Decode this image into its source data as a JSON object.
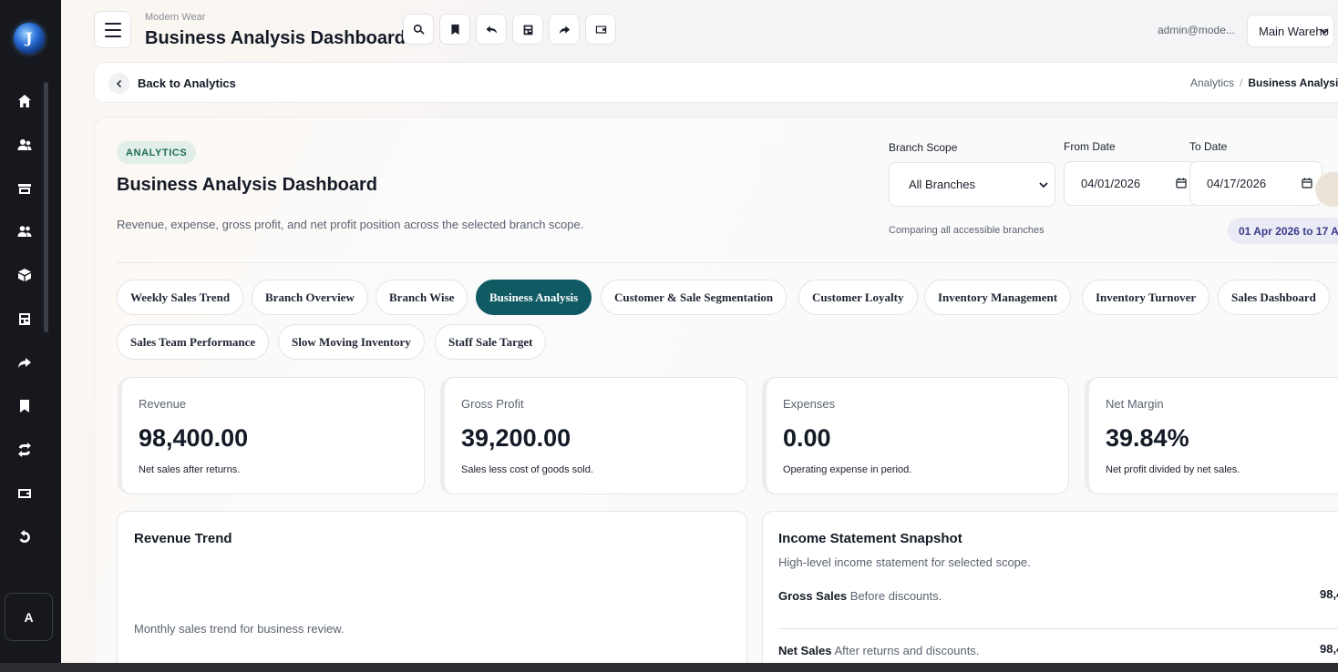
{
  "sidebar": {
    "logo_letter": "J",
    "icons": [
      "home-icon",
      "users-icon",
      "store-icon",
      "contacts-icon",
      "package-icon",
      "storefront-icon",
      "forward-icon",
      "bookmark-icon",
      "swap-icon",
      "wallet-icon",
      "return-icon"
    ],
    "avatar_letter": "A"
  },
  "header": {
    "brand_sub": "Modern Wear",
    "brand_title": "Business Analysis Dashboard",
    "user_email": "admin@mode...",
    "warehouse": "Main Wareho"
  },
  "breadcrumb_bar": {
    "back_label": "Back to Analytics",
    "crumb_parent": "Analytics",
    "crumb_sep": "/",
    "crumb_current": "Business Analysi"
  },
  "hero": {
    "badge": "ANALYTICS",
    "title": "Business Analysis Dashboard",
    "description": "Revenue, expense, gross profit, and net profit position across the selected branch scope."
  },
  "filters": {
    "branch_scope_label": "Branch Scope",
    "branch_scope_value": "All Branches",
    "from_date_label": "From Date",
    "from_date_value": "04/01/2026",
    "to_date_label": "To Date",
    "to_date_value": "04/17/2026",
    "scope_note": "Comparing all accessible branches",
    "range_pill": "01 Apr 2026 to 17 Ap"
  },
  "tabs": [
    {
      "label": "Weekly Sales Trend",
      "active": false
    },
    {
      "label": "Branch Overview",
      "active": false
    },
    {
      "label": "Branch Wise",
      "active": false
    },
    {
      "label": "Business Analysis",
      "active": true
    },
    {
      "label": "Customer & Sale Segmentation",
      "active": false
    },
    {
      "label": "Customer Loyalty",
      "active": false
    },
    {
      "label": "Inventory Management",
      "active": false
    },
    {
      "label": "Inventory Turnover",
      "active": false
    },
    {
      "label": "Sales Dashboard",
      "active": false
    },
    {
      "label": "Sales Team Performance",
      "active": false
    },
    {
      "label": "Slow Moving Inventory",
      "active": false
    },
    {
      "label": "Staff Sale Target",
      "active": false
    }
  ],
  "kpis": [
    {
      "label": "Revenue",
      "value": "98,400.00",
      "note": "Net sales after returns."
    },
    {
      "label": "Gross Profit",
      "value": "39,200.00",
      "note": "Sales less cost of goods sold."
    },
    {
      "label": "Expenses",
      "value": "0.00",
      "note": "Operating expense in period."
    },
    {
      "label": "Net Margin",
      "value": "39.84%",
      "note": "Net profit divided by net sales."
    }
  ],
  "revenue_trend": {
    "title": "Revenue Trend",
    "subtitle": "Monthly sales trend for business review."
  },
  "income_statement": {
    "title": "Income Statement Snapshot",
    "subtitle": "High-level income statement for selected scope.",
    "rows": [
      {
        "name": "Gross Sales",
        "desc": "Before discounts.",
        "value": "98,4"
      },
      {
        "name": "Net Sales",
        "desc": "After returns and discounts.",
        "value": "98,4"
      }
    ]
  },
  "colors": {
    "sidebar_bg": "#16181d",
    "active_tab": "#0f5a63",
    "badge_bg": "#e2efe9",
    "badge_text": "#1f6b55",
    "date_pill_text": "#3b3c8c"
  }
}
